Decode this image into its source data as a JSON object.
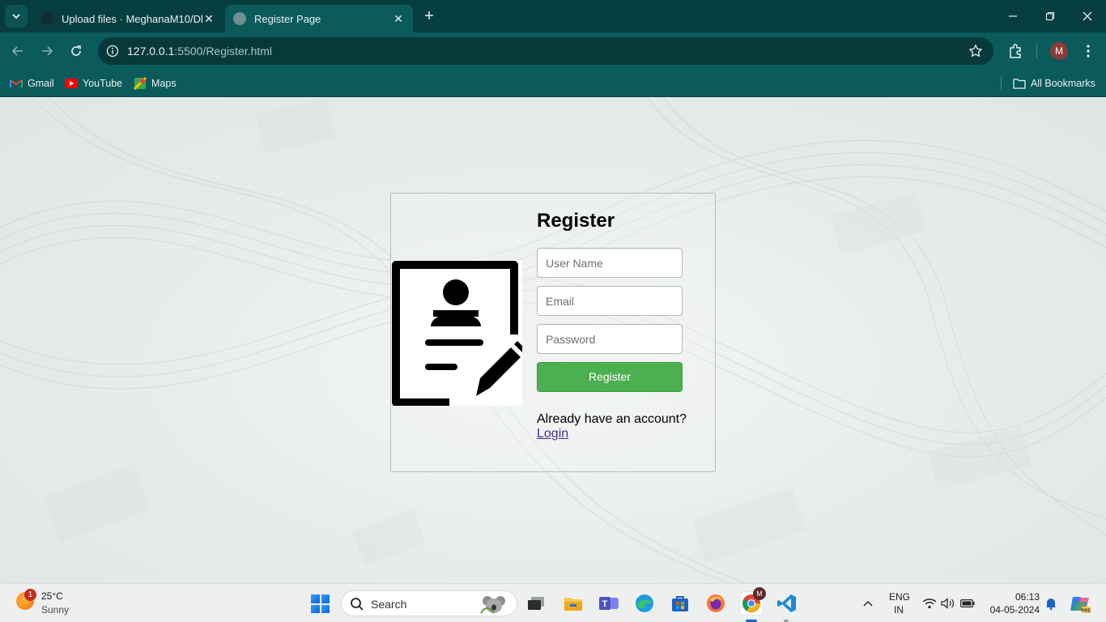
{
  "browser": {
    "tabs": [
      {
        "title": "Upload files · MeghanaM10/Dl",
        "active": false
      },
      {
        "title": "Register Page",
        "active": true
      }
    ],
    "url_host": "127.0.0.1",
    "url_path": ":5500/Register.html",
    "profile_initial": "M",
    "bookmarks": [
      {
        "label": "Gmail",
        "icon": "gmail-icon"
      },
      {
        "label": "YouTube",
        "icon": "youtube-icon"
      },
      {
        "label": "Maps",
        "icon": "maps-icon"
      }
    ],
    "all_bookmarks_label": "All Bookmarks"
  },
  "form": {
    "heading": "Register",
    "username_placeholder": "User Name",
    "email_placeholder": "Email",
    "password_placeholder": "Password",
    "submit_label": "Register",
    "account_prompt": "Already have an account?",
    "login_link": "Login",
    "button_color": "#4caf50"
  },
  "taskbar": {
    "weather_temp": "25°C",
    "weather_desc": "Sunny",
    "weather_badge": "1",
    "search_placeholder": "Search",
    "language_line1": "ENG",
    "language_line2": "IN",
    "time": "06:13",
    "date": "04-05-2024",
    "chrome_badge": "M"
  }
}
